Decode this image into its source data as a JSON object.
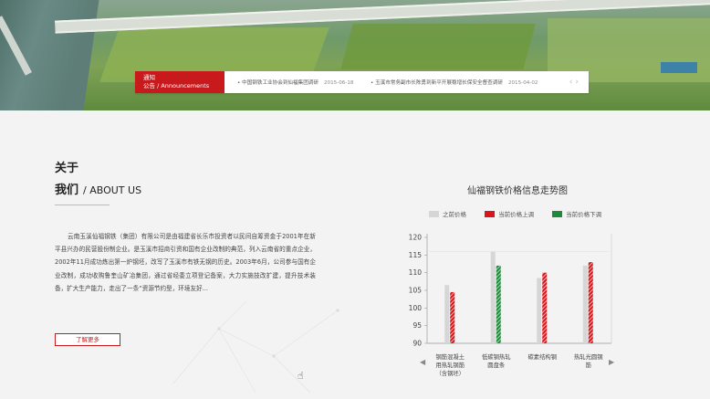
{
  "announcement": {
    "tag_cn": "通知",
    "tag_line2": "公告 / Announcements",
    "items": [
      {
        "title": "• 中国钢铁工业协会到仙福集团调研",
        "date": "2015-06-18"
      },
      {
        "title": "• 玉溪市常务副市长陈勇到新平开展稳增长保安全督查调研",
        "date": "2015-04-02"
      }
    ],
    "prev": "‹",
    "next": "›"
  },
  "about": {
    "title_line1": "关于",
    "title_line2_cn": "我们",
    "title_line2_en": "/ ABOUT US",
    "text": "云南玉溪仙福钢铁（集团）有限公司是由福建省长乐市投资者以民间自筹资金于2001年在新平县兴办的民营股份制企业。是玉溪市招商引资和国有企业改制的典范，列入云南省的重点企业，2002年11月成功炼出第一炉钢坯，改写了玉溪市有铁无钢的历史。2003年6月，公司参与国有企业改制，成功收购鲁奎山矿冶集团，通过省经委立项登记备案，大力实施技改扩建，提升技术装备，扩大生产能力，走出了一条“资源节约型，环境友好...",
    "more_label": "了解更多"
  },
  "chart_data": {
    "type": "bar",
    "title": "仙福钢铁价格信息走势图",
    "legend": [
      "之前价格",
      "当前价格上调",
      "当前价格下调"
    ],
    "colors": {
      "previous": "#d6d6d6",
      "up": "#d9151b",
      "down": "#1f8a3c"
    },
    "categories": [
      "钢筋混凝土用热轧钢筋（含钢坯）",
      "低碳钢热轧圆盘条",
      "碳素结构钢",
      "热轧光圆钢筋"
    ],
    "series": [
      {
        "name": "之前价格",
        "values": [
          106.5,
          116,
          108.5,
          112
        ]
      },
      {
        "name": "当前价格",
        "values": [
          104.5,
          112,
          110,
          113
        ],
        "direction": [
          "up",
          "down",
          "up",
          "up"
        ]
      }
    ],
    "ylim": [
      90,
      120
    ],
    "yticks": [
      90,
      95,
      100,
      105,
      110,
      115,
      120
    ],
    "grid": false,
    "legend_position": "top"
  },
  "chart_pager": {
    "prev": "◀",
    "next": "▶"
  }
}
